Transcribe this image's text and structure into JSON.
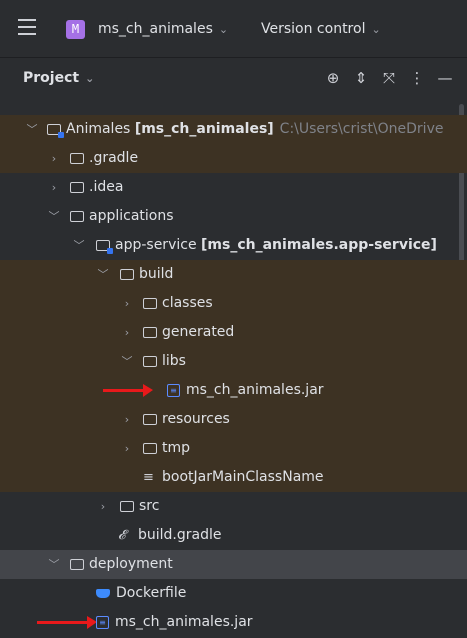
{
  "topbar": {
    "project_badge": "M",
    "project_name": "ms_ch_animales",
    "vcs_label": "Version control",
    "chevron": "⌄"
  },
  "panel": {
    "title": "Project",
    "tools": [
      "crosshair-icon",
      "expand-icon",
      "collapse-icon",
      "more-icon",
      "minimize-icon"
    ]
  },
  "tree": [
    {
      "label": "Animales",
      "module": "[ms_ch_animales]",
      "path": "C:\\Users\\crist\\OneDrive",
      "icon": "module",
      "expanded": true,
      "hl": true
    },
    {
      "label": ".gradle",
      "icon": "folder",
      "expanded": false,
      "hl": true
    },
    {
      "label": ".idea",
      "icon": "folder",
      "expanded": false
    },
    {
      "label": "applications",
      "icon": "folder",
      "expanded": true
    },
    {
      "label": "app-service",
      "module": "[ms_ch_animales.app-service]",
      "icon": "module",
      "expanded": true
    },
    {
      "label": "build",
      "icon": "folder",
      "expanded": true,
      "hl": true
    },
    {
      "label": "classes",
      "icon": "folder",
      "expanded": false,
      "hl": true
    },
    {
      "label": "generated",
      "icon": "folder",
      "expanded": false,
      "hl": true
    },
    {
      "label": "libs",
      "icon": "folder",
      "expanded": true,
      "hl": true
    },
    {
      "label": "ms_ch_animales.jar",
      "icon": "jar",
      "hl": true,
      "marker": true
    },
    {
      "label": "resources",
      "icon": "folder",
      "expanded": false,
      "hl": true
    },
    {
      "label": "tmp",
      "icon": "folder",
      "expanded": false,
      "hl": true
    },
    {
      "label": "bootJarMainClassName",
      "icon": "lines",
      "hl": true
    },
    {
      "label": "src",
      "icon": "folder",
      "expanded": false
    },
    {
      "label": "build.gradle",
      "icon": "gradle"
    },
    {
      "label": "deployment",
      "icon": "folder",
      "expanded": true,
      "sel": true
    },
    {
      "label": "Dockerfile",
      "icon": "docker"
    },
    {
      "label": "ms_ch_animales.jar",
      "icon": "jar",
      "marker": true
    }
  ],
  "colors": {
    "highlight": "#3d3223",
    "selected": "#43454a",
    "marker": "#e8191b"
  }
}
